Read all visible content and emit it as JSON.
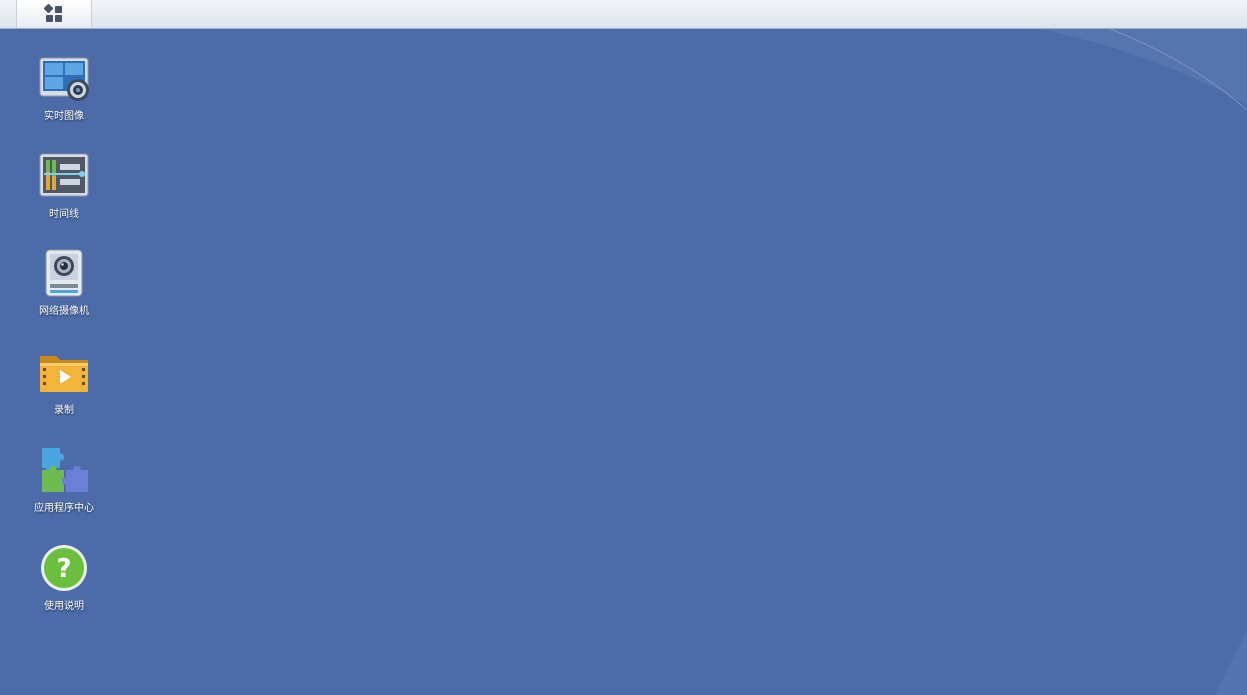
{
  "taskbar": {
    "main_menu_icon": "grid-icon"
  },
  "desktop": {
    "background_color": "#4c6ba8",
    "shortcuts": [
      {
        "label": "实时图像",
        "icon": "live-view-icon"
      },
      {
        "label": "时间线",
        "icon": "timeline-icon"
      },
      {
        "label": "网络摄像机",
        "icon": "ip-camera-icon"
      },
      {
        "label": "录制",
        "icon": "recording-folder-icon"
      },
      {
        "label": "应用程序中心",
        "icon": "puzzle-icon"
      },
      {
        "label": "使用说明",
        "icon": "help-icon"
      }
    ]
  }
}
